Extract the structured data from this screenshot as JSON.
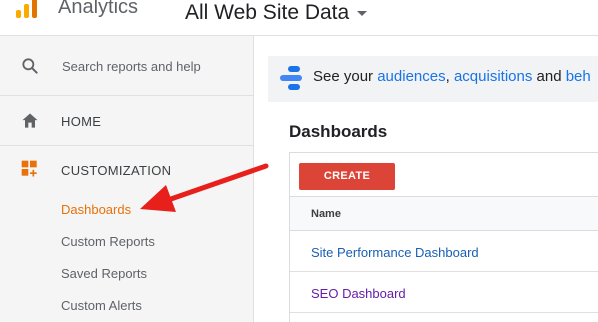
{
  "header": {
    "app_name": "Analytics",
    "view_name": "All Web Site Data"
  },
  "sidebar": {
    "search_placeholder": "Search reports and help",
    "home_label": "HOME",
    "customization_label": "CUSTOMIZATION",
    "sub_items": [
      {
        "label": "Dashboards",
        "active": true
      },
      {
        "label": "Custom Reports",
        "active": false
      },
      {
        "label": "Saved Reports",
        "active": false
      },
      {
        "label": "Custom Alerts",
        "active": false
      }
    ]
  },
  "banner": {
    "prefix": "See your",
    "link1": "audiences",
    "sep": ",",
    "link2": "acquisitions",
    "and_text": "and",
    "link3": "beh"
  },
  "main": {
    "title": "Dashboards",
    "create_label": "CREATE",
    "column_name": "Name",
    "rows": [
      {
        "name": "Site Performance Dashboard",
        "visited": false
      },
      {
        "name": "SEO Dashboard",
        "visited": true
      }
    ]
  },
  "colors": {
    "accent_orange": "#e8710a",
    "create_red": "#db4437",
    "link_blue": "#1a73e8",
    "visited_purple": "#681da8",
    "arrow_red": "#e8201b"
  }
}
